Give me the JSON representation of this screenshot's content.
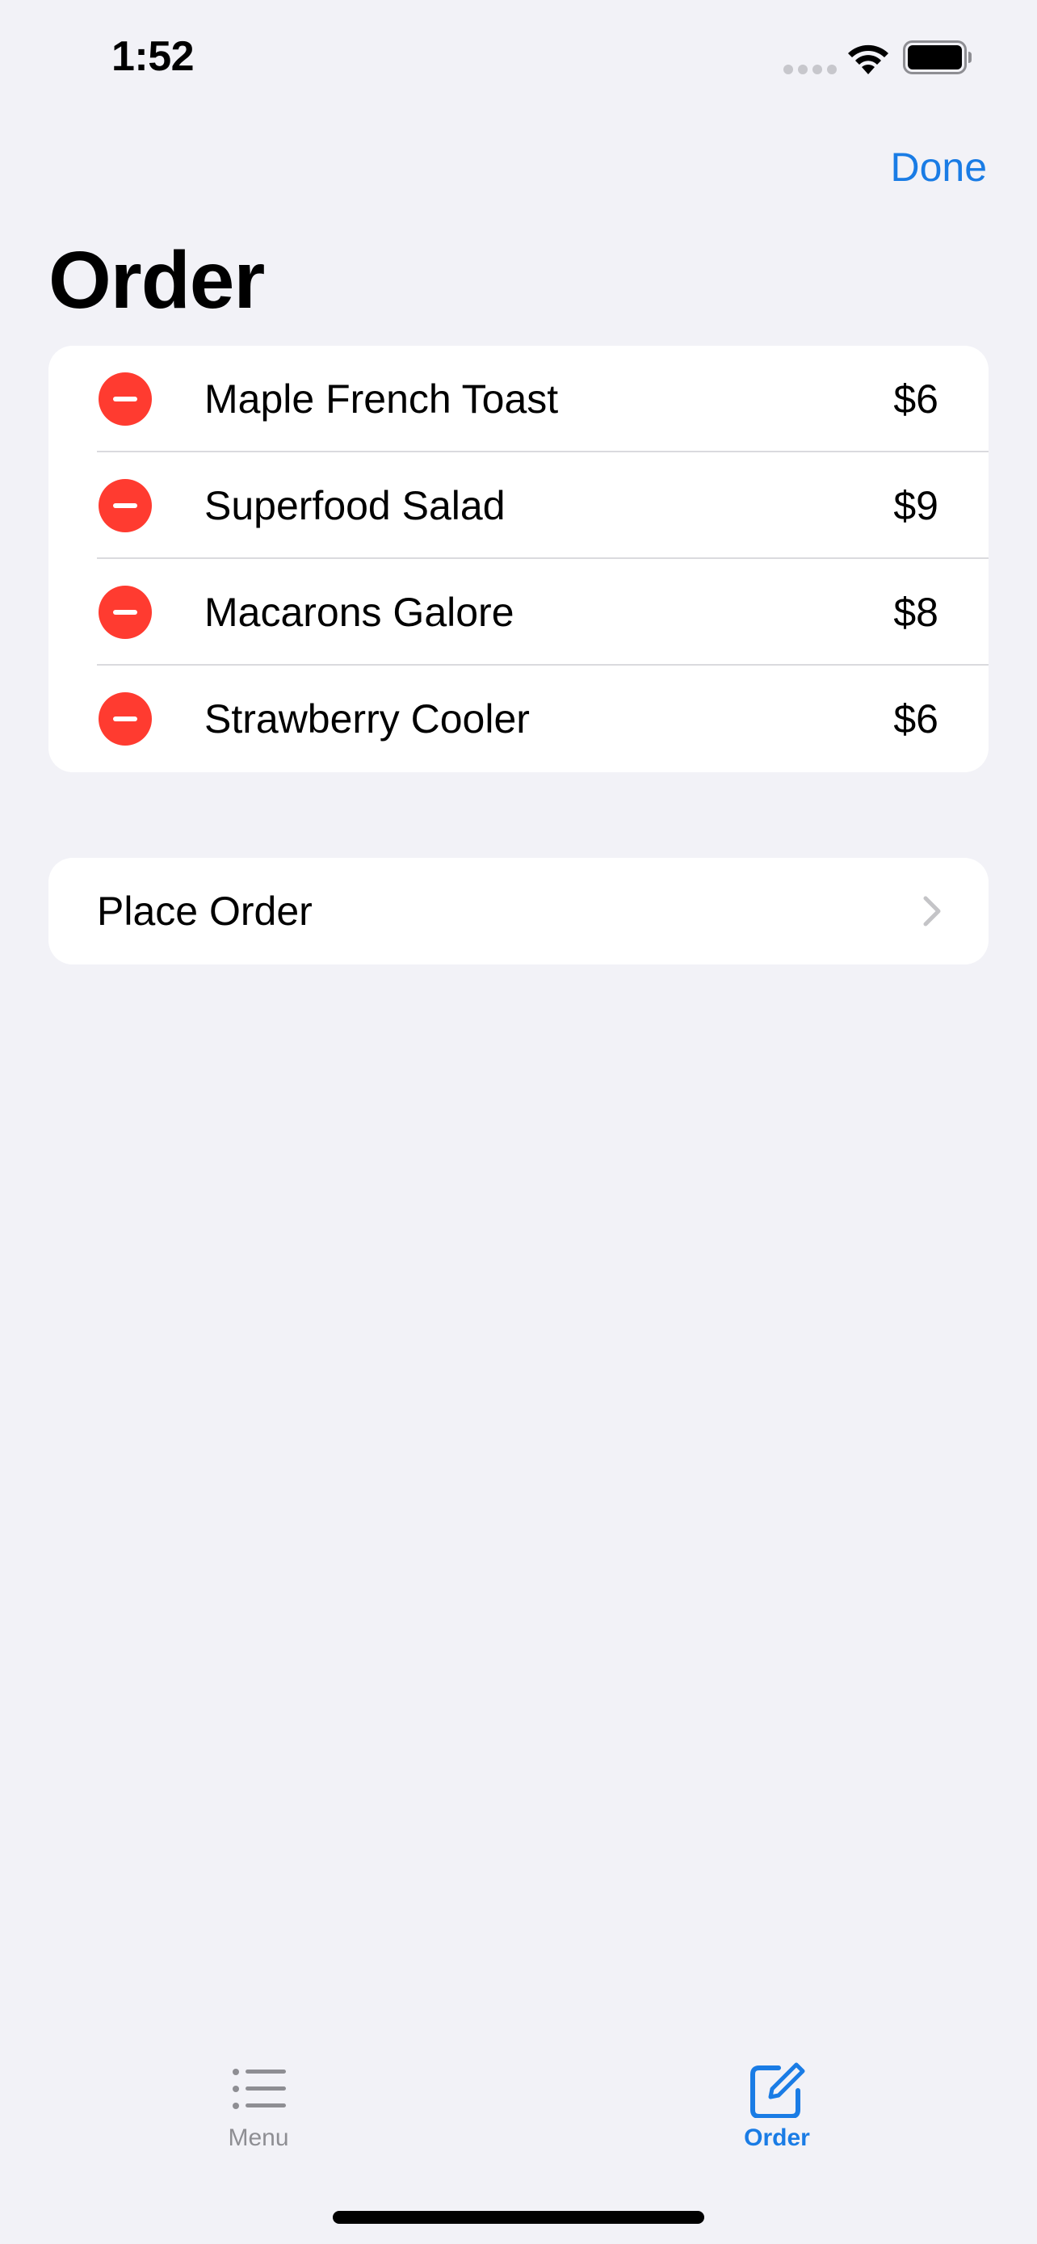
{
  "status_bar": {
    "time": "1:52",
    "icons": [
      "signal-icon",
      "wifi-icon",
      "battery-icon"
    ]
  },
  "nav": {
    "done_label": "Done",
    "title": "Order"
  },
  "order_items": [
    {
      "name": "Maple French Toast",
      "price": "$6"
    },
    {
      "name": "Superfood Salad",
      "price": "$9"
    },
    {
      "name": "Macarons Galore",
      "price": "$8"
    },
    {
      "name": "Strawberry Cooler",
      "price": "$6"
    }
  ],
  "place_order": {
    "label": "Place Order",
    "icon": "chevron-right-icon"
  },
  "tab_bar": {
    "tabs": [
      {
        "label": "Menu",
        "icon": "list-icon",
        "selected": false
      },
      {
        "label": "Order",
        "icon": "edit-icon",
        "selected": true
      }
    ]
  },
  "colors": {
    "accent": "#1A7CE5",
    "delete": "#FF3B30",
    "background": "#F2F2F7",
    "inactive": "#8E8E93"
  }
}
